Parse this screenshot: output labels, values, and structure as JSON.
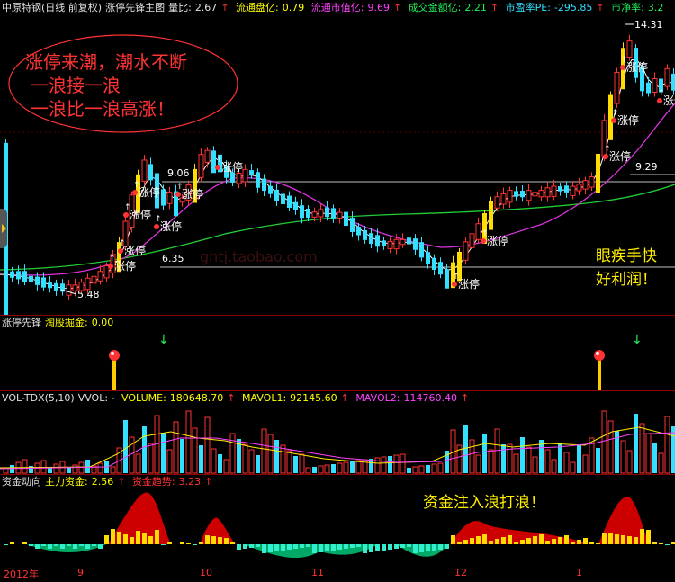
{
  "main": {
    "header": {
      "title": "中原特钢(日线 前复权)",
      "indicator": "涨停先锋主图",
      "volume_ratio_label": "量比:",
      "volume_ratio_value": "2.67",
      "float_cap_label": "流通盘亿:",
      "float_cap_value": "0.79",
      "float_mktval_label": "流通市值亿:",
      "float_mktval_value": "9.69",
      "turnover_label": "成交金额亿:",
      "turnover_value": "2.21",
      "pe_label": "市盈率PE:",
      "pe_value": "-295.85",
      "pb_label": "市净率:",
      "pb_value": "3.2",
      "up_arrow": "↑"
    },
    "price_labels": {
      "high": "14.31",
      "p1": "9.06",
      "p2": "9.29",
      "p3": "6.35",
      "low": "5.48"
    },
    "limit_up_label": "涨停",
    "watermark": "ghtj.taobao.com",
    "annotation_1": [
      "涨停来潮，潮水不断",
      "一浪接一浪",
      "一浪比一浪高涨！"
    ],
    "annotation_2": [
      "眼疾手快",
      "好利润！"
    ]
  },
  "panel2": {
    "name": "涨停先锋",
    "sub_label": "淘股掘金:",
    "sub_value": "0.00"
  },
  "panel3": {
    "name": "VOL-TDX(5,10)",
    "vvol": "VVOL: -",
    "volume_label": "VOLUME:",
    "volume_value": "180648.70",
    "mavol1_label": "MAVOL1:",
    "mavol1_value": "92145.60",
    "mavol2_label": "MAVOL2:",
    "mavol2_value": "114760.40",
    "up_arrow": "↑"
  },
  "panel4": {
    "name": "资金动向",
    "main_label": "主力资金:",
    "main_value": "2.56",
    "trend_label": "资金趋势:",
    "trend_value": "3.23",
    "up_arrow": "↑",
    "annotation": "资金注入浪打浪！"
  },
  "dates": {
    "year": "2012年",
    "m9": "9",
    "m10": "10",
    "m11": "11",
    "m12": "12",
    "m1": "1"
  },
  "colors": {
    "up": "#ff3333",
    "down": "#33e0ff",
    "limit": "#ffdd00",
    "ma_white": "#ffffff",
    "ma_magenta": "#dd33dd",
    "ma_green": "#22cc33",
    "divider": "#8b0000"
  },
  "chart_data": {
    "type": "candlestick",
    "x_axis": [
      "9",
      "10",
      "11",
      "12",
      "1"
    ],
    "price_markers": [
      5.48,
      6.35,
      9.06,
      9.29,
      14.31
    ]
  }
}
